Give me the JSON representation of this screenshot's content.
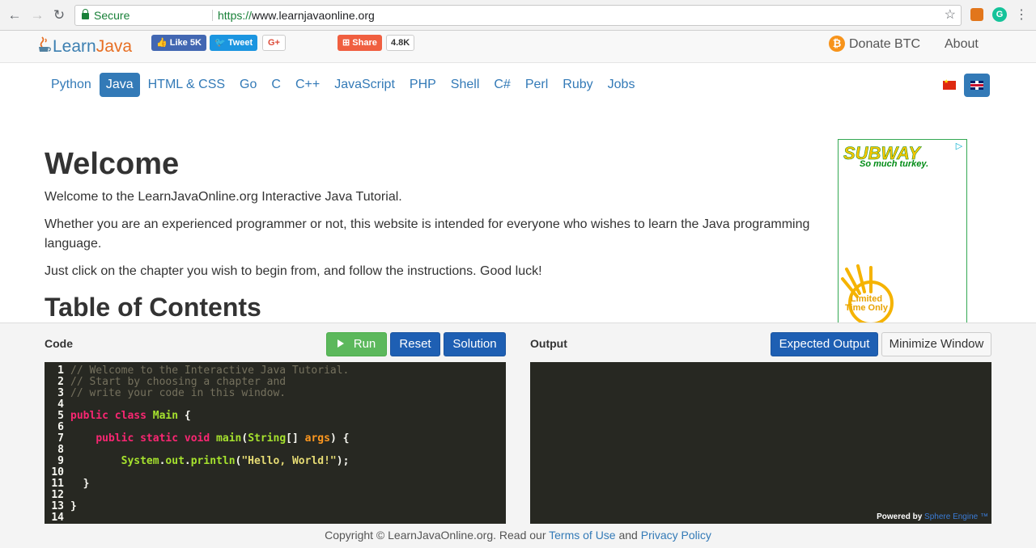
{
  "browser": {
    "secure_label": "Secure",
    "url_scheme": "https://",
    "url_host": "www.learnjavaonline.org"
  },
  "header": {
    "logo_learn": "Learn",
    "logo_java": "Java",
    "fb_like": "Like 5K",
    "tweet": "Tweet",
    "gplus": "G+",
    "share": "Share",
    "share_count": "4.8K",
    "donate": "Donate BTC",
    "about": "About"
  },
  "languages": [
    "Python",
    "Java",
    "HTML & CSS",
    "Go",
    "C",
    "C++",
    "JavaScript",
    "PHP",
    "Shell",
    "C#",
    "Perl",
    "Ruby",
    "Jobs"
  ],
  "active_language": "Java",
  "content": {
    "title": "Welcome",
    "p1": "Welcome to the LearnJavaOnline.org Interactive Java Tutorial.",
    "p2": "Whether you are an experienced programmer or not, this website is intended for everyone who wishes to learn the Java programming language.",
    "p3": "Just click on the chapter you wish to begin from, and follow the instructions. Good luck!",
    "toc_title": "Table of Contents"
  },
  "ad": {
    "brand_sub": "SUB",
    "brand_way": "WAY",
    "tagline": "So much turkey.",
    "limited": "Limited\nTime Only"
  },
  "panel": {
    "code_label": "Code",
    "output_label": "Output",
    "run": "Run",
    "reset": "Reset",
    "solution": "Solution",
    "expected_output": "Expected Output",
    "minimize": "Minimize Window",
    "powered_by": "Powered by",
    "sphere_engine": "Sphere Engine ™"
  },
  "code_lines": [
    "// Welcome to the Interactive Java Tutorial.",
    "// Start by choosing a chapter and",
    "// write your code in this window.",
    "",
    "public class Main {",
    "",
    "    public static void main(String[] args) {",
    "",
    "        System.out.println(\"Hello, World!\");",
    "",
    "  }",
    "",
    "}",
    ""
  ],
  "footer": {
    "copyright": "Copyright © LearnJavaOnline.org. Read our",
    "terms": "Terms of Use",
    "and": "and",
    "privacy": "Privacy Policy"
  },
  "colors": {
    "link": "#337ab7",
    "run_green": "#5cb85c",
    "primary_blue": "#1e5fb3",
    "editor_bg": "#272822"
  }
}
